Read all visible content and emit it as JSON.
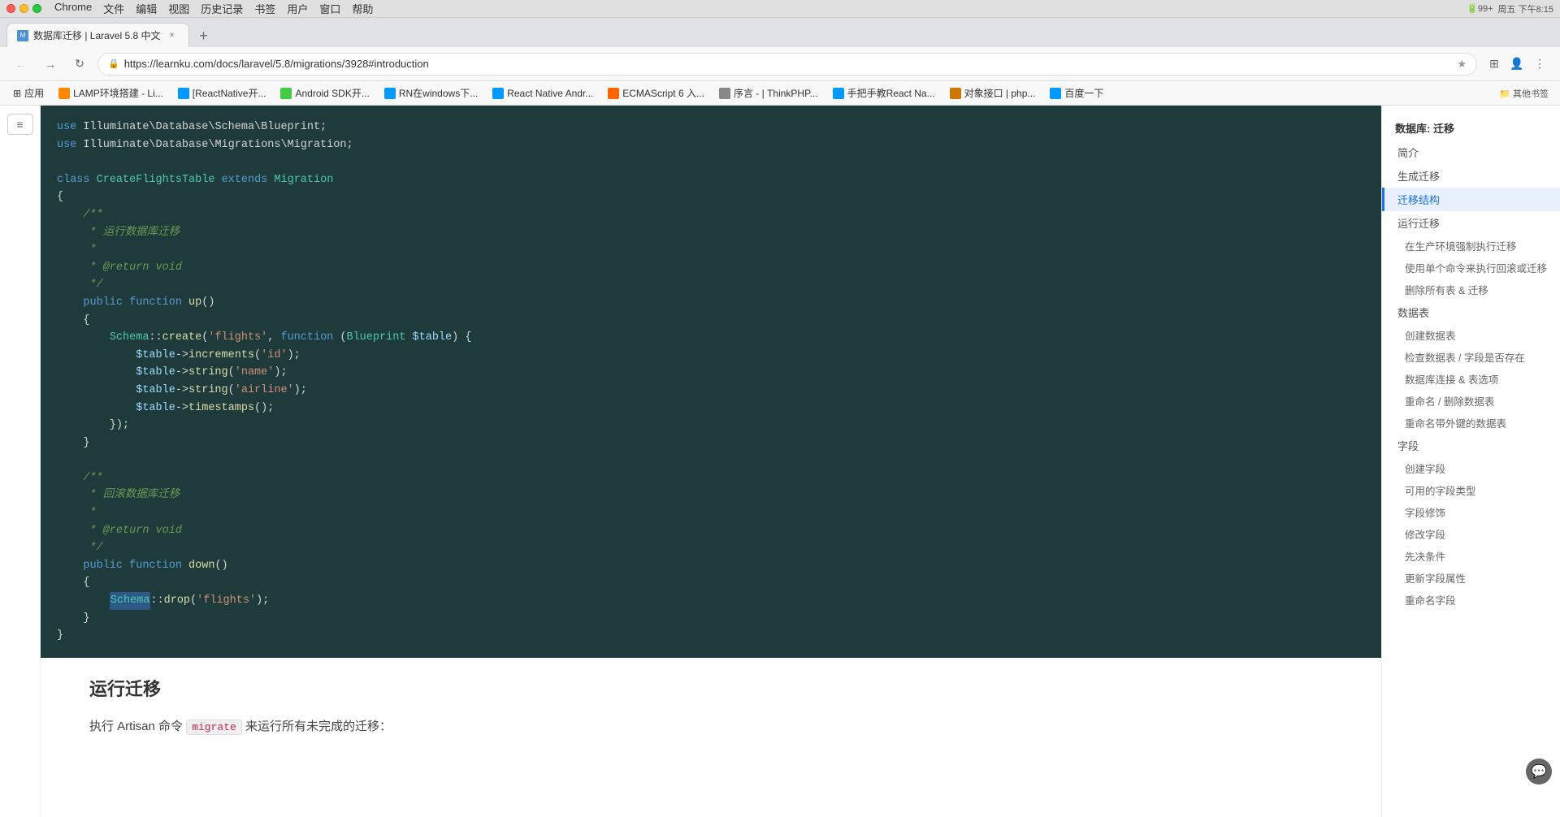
{
  "titlebar": {
    "app_name": "Chrome",
    "menus": [
      "文件",
      "编辑",
      "视图",
      "历史记录",
      "书签",
      "用户",
      "窗口",
      "帮助"
    ],
    "battery": "99+",
    "time": "周五 下午8:15"
  },
  "tab": {
    "favicon": "M",
    "title": "数据库迁移 | Laravel 5.8 中文",
    "close": "×"
  },
  "address_bar": {
    "url": "https://learnku.com/docs/laravel/5.8/migrations/3928#introduction"
  },
  "bookmarks": [
    {
      "label": "应用"
    },
    {
      "label": "LAMP环境搭建 - Li..."
    },
    {
      "label": "[ReactNative开..."
    },
    {
      "label": "Android SDK开..."
    },
    {
      "label": "RN在windows下..."
    },
    {
      "label": "React Native Andr..."
    },
    {
      "label": "ECMAScript 6 入..."
    },
    {
      "label": "序言 - | ThinkPHP..."
    },
    {
      "label": "手把手教React Na..."
    },
    {
      "label": "对象接口 | php..."
    },
    {
      "label": "百度一下"
    },
    {
      "label": "其他书签"
    }
  ],
  "code": {
    "lines": [
      {
        "type": "use",
        "text": "use Illuminate\\Database\\Schema\\Blueprint;"
      },
      {
        "type": "use",
        "text": "use Illuminate\\Database\\Migrations\\Migration;"
      },
      {
        "type": "blank",
        "text": ""
      },
      {
        "type": "class",
        "text": "class CreateFlightsTable extends Migration"
      },
      {
        "type": "brace_open",
        "text": "{"
      },
      {
        "type": "comment",
        "text": "    /**"
      },
      {
        "type": "comment",
        "text": "     * 运行数据库迁移"
      },
      {
        "type": "comment",
        "text": "     *"
      },
      {
        "type": "comment",
        "text": "     * @return void"
      },
      {
        "type": "comment",
        "text": "     */"
      },
      {
        "type": "method",
        "text": "    public function up()"
      },
      {
        "type": "brace_open2",
        "text": "    {"
      },
      {
        "type": "schema",
        "text": "        Schema::create('flights', function (Blueprint $table) {"
      },
      {
        "type": "table",
        "text": "            $table->increments('id');"
      },
      {
        "type": "table",
        "text": "            $table->string('name');"
      },
      {
        "type": "table",
        "text": "            $table->string('airline');"
      },
      {
        "type": "table",
        "text": "            $table->timestamps();"
      },
      {
        "type": "brace_close3",
        "text": "        });"
      },
      {
        "type": "brace_close2",
        "text": "    }"
      },
      {
        "type": "blank",
        "text": ""
      },
      {
        "type": "comment",
        "text": "    /**"
      },
      {
        "type": "comment",
        "text": "     * 回滚数据库迁移"
      },
      {
        "type": "comment",
        "text": "     *"
      },
      {
        "type": "comment",
        "text": "     * @return void"
      },
      {
        "type": "comment",
        "text": "     */"
      },
      {
        "type": "method",
        "text": "    public function down()"
      },
      {
        "type": "brace_open2",
        "text": "    {"
      },
      {
        "type": "drop",
        "text": "        Schema::drop('flights');"
      },
      {
        "type": "brace_close2",
        "text": "    }"
      },
      {
        "type": "brace_close",
        "text": "}"
      }
    ]
  },
  "section": {
    "title": "运行迁移",
    "text_before": "执行 Artisan 命令 ",
    "command": "migrate",
    "text_after": " 来运行所有未完成的迁移："
  },
  "toc": {
    "header": "数据库: 迁移",
    "items": [
      {
        "label": "简介",
        "level": 1,
        "active": false
      },
      {
        "label": "生成迁移",
        "level": 1,
        "active": false
      },
      {
        "label": "迁移结构",
        "level": 1,
        "active": true
      },
      {
        "label": "运行迁移",
        "level": 1,
        "active": false
      },
      {
        "label": "在生产环境强制执行迁移",
        "level": 2,
        "active": false
      },
      {
        "label": "使用单个命令来执行回滚或迁移",
        "level": 2,
        "active": false
      },
      {
        "label": "删除所有表 & 迁移",
        "level": 2,
        "active": false
      },
      {
        "label": "数据表",
        "level": 1,
        "active": false
      },
      {
        "label": "创建数据表",
        "level": 2,
        "active": false
      },
      {
        "label": "检查数据表 / 字段是否存在",
        "level": 2,
        "active": false
      },
      {
        "label": "数据库连接 & 表选项",
        "level": 2,
        "active": false
      },
      {
        "label": "重命名 / 删除数据表",
        "level": 2,
        "active": false
      },
      {
        "label": "重命名带外键的数据表",
        "level": 2,
        "active": false
      },
      {
        "label": "字段",
        "level": 1,
        "active": false
      },
      {
        "label": "创建字段",
        "level": 2,
        "active": false
      },
      {
        "label": "可用的字段类型",
        "level": 2,
        "active": false
      },
      {
        "label": "字段修饰",
        "level": 2,
        "active": false
      },
      {
        "label": "修改字段",
        "level": 2,
        "active": false
      },
      {
        "label": "先决条件",
        "level": 2,
        "active": false
      },
      {
        "label": "更新字段属性",
        "level": 2,
        "active": false
      },
      {
        "label": "重命名字段",
        "level": 2,
        "active": false
      }
    ]
  }
}
